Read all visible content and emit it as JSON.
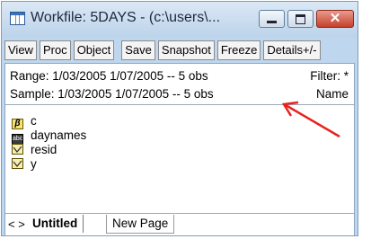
{
  "window": {
    "title": "Workfile: 5DAYS - (c:\\users\\..."
  },
  "title_buttons": {
    "minimize_icon": "minimize-icon",
    "maximize_icon": "maximize-icon",
    "close_label": "✕"
  },
  "toolbar": {
    "buttons": [
      "View",
      "Proc",
      "Object",
      "Save",
      "Snapshot",
      "Freeze",
      "Details+/-"
    ]
  },
  "info": {
    "range_label": "Range:  1/03/2005 1/07/2005  --  5 obs",
    "filter_label": "Filter: *",
    "sample_label": "Sample: 1/03/2005 1/07/2005  --  5 obs",
    "name_label": "Name"
  },
  "objects": [
    {
      "name": "c",
      "icon": "coefficient-icon"
    },
    {
      "name": "daynames",
      "icon": "alpha-series-icon"
    },
    {
      "name": "resid",
      "icon": "series-icon"
    },
    {
      "name": "y",
      "icon": "series-icon"
    }
  ],
  "tabs": {
    "nav": "< >",
    "items": [
      "Untitled",
      "New Page"
    ],
    "active": "Untitled"
  },
  "annotation": {
    "arrow_color": "#e8231e"
  }
}
